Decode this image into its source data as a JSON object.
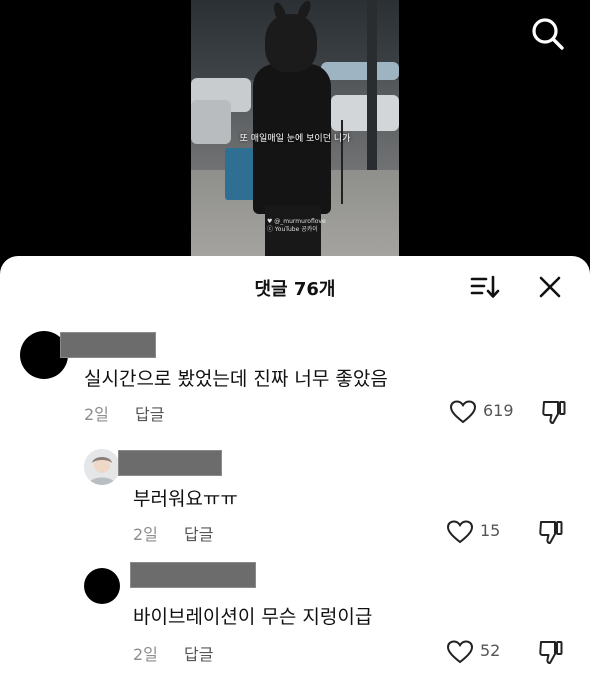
{
  "video": {
    "caption": "또 매일매일 눈에 보이던 니가",
    "watermark_line1": "♥ @_murmuroflove",
    "watermark_line2": "ⓒ YouTube 공카이"
  },
  "header": {
    "title": "댓글 76개",
    "sort_icon": "sort-descending-icon",
    "close_icon": "close-icon",
    "search_icon": "search-icon"
  },
  "comments": [
    {
      "text": "실시간으로 봤었는데 진짜 너무 좋았음",
      "time": "2일",
      "reply_label": "답글",
      "likes": "619"
    },
    {
      "text": "부러워요ㅠㅠ",
      "time": "2일",
      "reply_label": "답글",
      "likes": "15"
    },
    {
      "text": "바이브레이션이 무슨 지렁이급",
      "time": "2일",
      "reply_label": "답글",
      "likes": "52"
    }
  ],
  "colors": {
    "sheet_bg": "#ffffff",
    "text_primary": "#111111",
    "text_secondary": "#8e8e8e",
    "redaction": "#6c6c6c"
  }
}
